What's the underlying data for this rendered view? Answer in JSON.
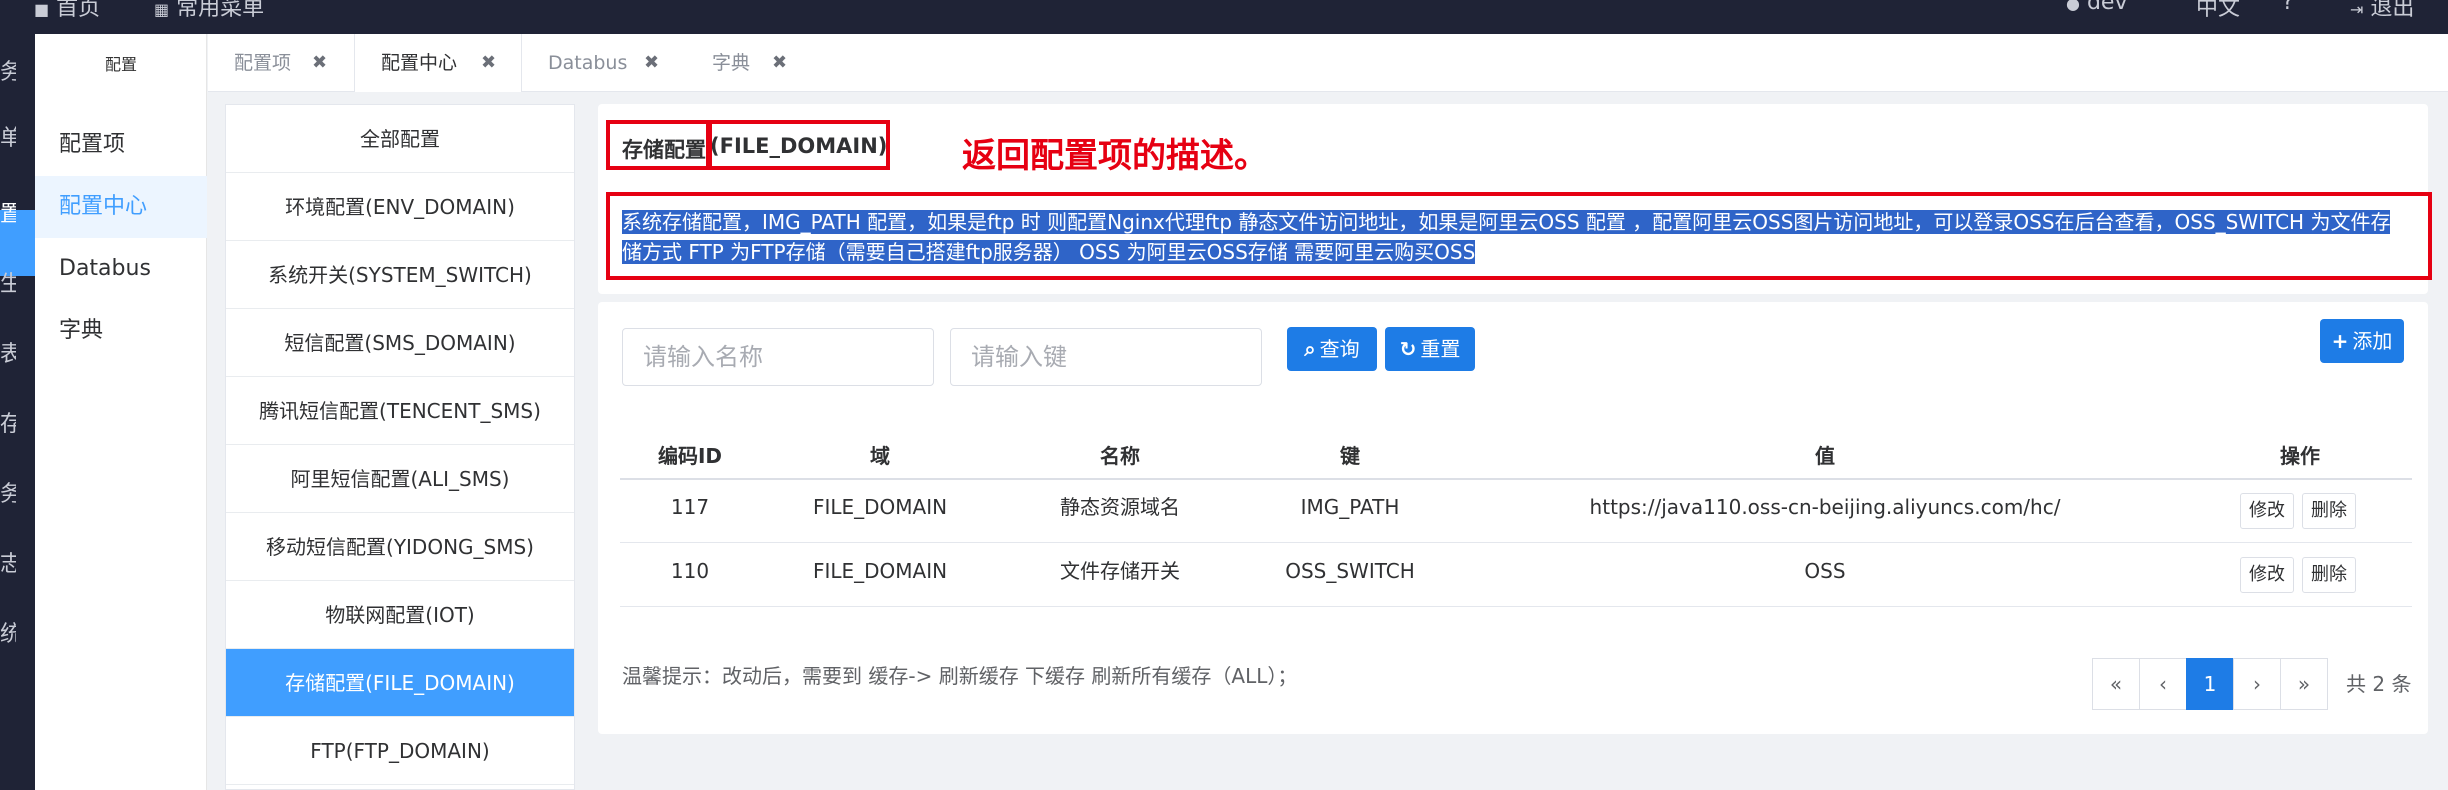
{
  "topbar": {
    "home": "首页",
    "nav2": "常用菜单",
    "user": "dev",
    "lang": "中文",
    "logout": "退出"
  },
  "rail": {
    "chars": [
      "务",
      "单",
      "置",
      "生",
      "表",
      "存",
      "务",
      "志",
      "统"
    ]
  },
  "submenu": {
    "header": "配置",
    "items": [
      "配置项",
      "配置中心",
      "Databus",
      "字典"
    ]
  },
  "tabs": [
    {
      "label": "配置项",
      "close": "✖"
    },
    {
      "label": "配置中心",
      "close": "✖"
    },
    {
      "label": "Databus",
      "close": "✖"
    },
    {
      "label": "字典",
      "close": "✖"
    }
  ],
  "groups": [
    "全部配置",
    "环境配置(ENV_DOMAIN)",
    "系统开关(SYSTEM_SWITCH)",
    "短信配置(SMS_DOMAIN)",
    "腾讯短信配置(TENCENT_SMS)",
    "阿里短信配置(ALI_SMS)",
    "移动短信配置(YIDONG_SMS)",
    "物联网配置(IOT)",
    "存储配置(FILE_DOMAIN)",
    "FTP(FTP_DOMAIN)"
  ],
  "detail": {
    "title_cn": "存储配置",
    "title_en": "(FILE_DOMAIN)",
    "annotation": "返回配置项的描述。",
    "desc_line1": "系统存储配置，IMG_PATH 配置，如果是ftp 时 则配置Nginx代理ftp 静态文件访问地址，如果是阿里云OSS 配置 ，配置阿里云OSS图片访问地址，可以登录OSS在后台查看，OSS_SWITCH 为文件存",
    "desc_line2": "储方式 FTP 为FTP存储（需要自己搭建ftp服务器） OSS 为阿里云OSS存储 需要阿里云购买OSS"
  },
  "search": {
    "name_placeholder": "请输入名称",
    "key_placeholder": "请输入键",
    "query_label": "查询",
    "reset_label": "重置",
    "add_label": "添加"
  },
  "table": {
    "headers": [
      "编码ID",
      "域",
      "名称",
      "键",
      "值",
      "操作"
    ],
    "rows": [
      {
        "id": "117",
        "domain": "FILE_DOMAIN",
        "name": "静态资源域名",
        "key": "IMG_PATH",
        "value": "https://java110.oss-cn-beijing.aliyuncs.com/hc/",
        "edit": "修改",
        "del": "删除"
      },
      {
        "id": "110",
        "domain": "FILE_DOMAIN",
        "name": "文件存储开关",
        "key": "OSS_SWITCH",
        "value": "OSS",
        "edit": "修改",
        "del": "删除"
      }
    ]
  },
  "tip": "温馨提示：改动后，需要到 缓存-> 刷新缓存 下缓存 刷新所有缓存（ALL）；",
  "pagination": {
    "first": "«",
    "prev": "‹",
    "current": "1",
    "next": "›",
    "last": "»",
    "total": "共 2 条"
  },
  "colors": {
    "accent": "#409eff",
    "annotation_red": "#e60012",
    "topbar": "#1f2336"
  }
}
